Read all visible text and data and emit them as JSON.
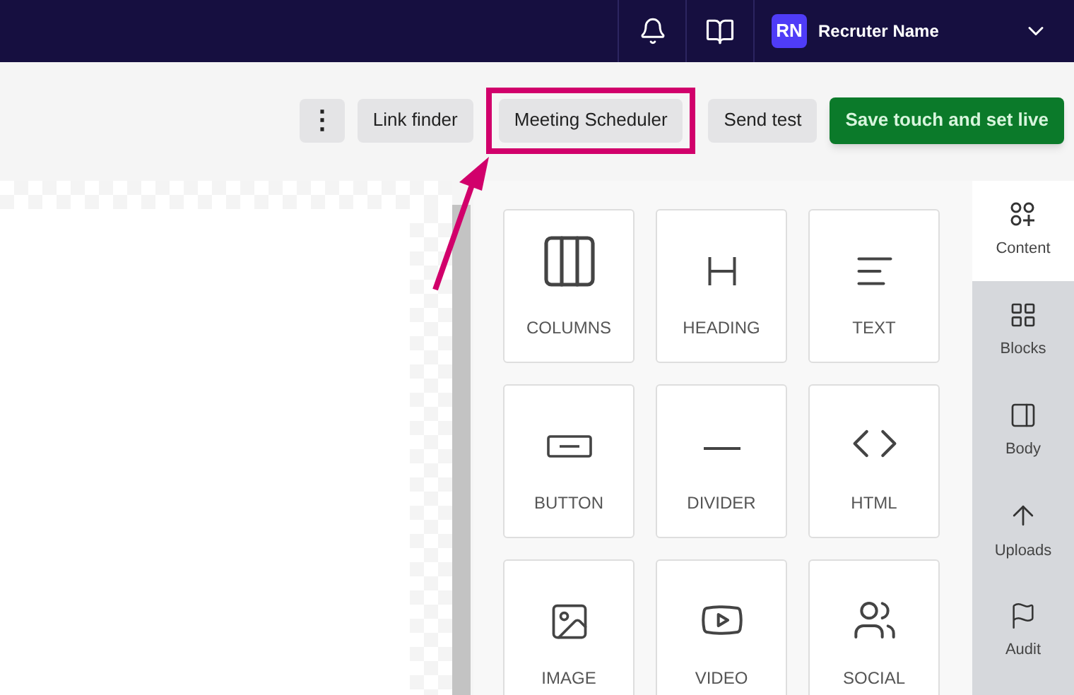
{
  "top_bar": {
    "avatar_initials": "RN",
    "user_name": "Recruter Name"
  },
  "toolbar": {
    "buttons": [
      {
        "kind": "more",
        "label": "⋮",
        "highlighted": false
      },
      {
        "kind": "plain",
        "label": "Link finder",
        "highlighted": false
      },
      {
        "kind": "plain",
        "label": "Meeting Scheduler",
        "highlighted": true
      },
      {
        "kind": "plain",
        "label": "Send test",
        "highlighted": false
      },
      {
        "kind": "primary",
        "label": "Save touch and set live",
        "highlighted": false
      }
    ]
  },
  "content_tiles": [
    {
      "kind": "columns",
      "label": "COLUMNS"
    },
    {
      "kind": "heading",
      "label": "HEADING"
    },
    {
      "kind": "text",
      "label": "TEXT"
    },
    {
      "kind": "button",
      "label": "BUTTON"
    },
    {
      "kind": "divider",
      "label": "DIVIDER"
    },
    {
      "kind": "html",
      "label": "HTML"
    },
    {
      "kind": "image",
      "label": "IMAGE"
    },
    {
      "kind": "video",
      "label": "VIDEO"
    },
    {
      "kind": "social",
      "label": "SOCIAL"
    }
  ],
  "side_tabs": [
    {
      "kind": "content",
      "label": "Content",
      "selected": true
    },
    {
      "kind": "blocks",
      "label": "Blocks",
      "selected": false
    },
    {
      "kind": "body",
      "label": "Body",
      "selected": false
    },
    {
      "kind": "uploads",
      "label": "Uploads",
      "selected": false
    },
    {
      "kind": "audit",
      "label": "Audit",
      "selected": false
    }
  ]
}
